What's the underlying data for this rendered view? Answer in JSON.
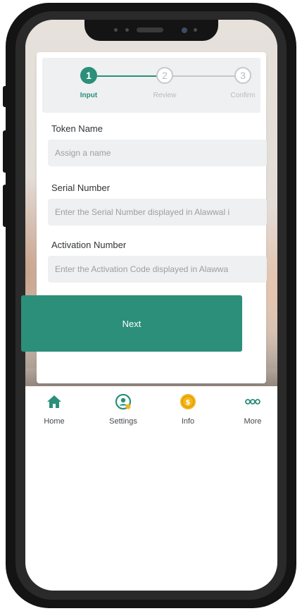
{
  "stepper": {
    "steps": [
      {
        "number": "1",
        "label": "Input"
      },
      {
        "number": "2",
        "label": "Review"
      },
      {
        "number": "3",
        "label": "Confirm"
      }
    ],
    "active_step": 1
  },
  "form": {
    "token_name": {
      "label": "Token Name",
      "placeholder": "Assign a name"
    },
    "serial_number": {
      "label": "Serial Number",
      "placeholder": "Enter the Serial Number displayed in Alawwal i"
    },
    "activation_number": {
      "label": "Activation Number",
      "placeholder": "Enter the Activation Code displayed in Alawwa"
    }
  },
  "next_button": {
    "label": "Next"
  },
  "bottom_nav": {
    "items": [
      {
        "label": "Home",
        "icon": "home-icon"
      },
      {
        "label": "Settings",
        "icon": "settings-user-icon"
      },
      {
        "label": "Info",
        "icon": "info-coin-icon"
      },
      {
        "label": "More",
        "icon": "more-dots-icon"
      }
    ]
  },
  "colors": {
    "accent": "#2b8f7a",
    "info_gold": "#f3b71a",
    "field_bg": "#eef0f1"
  }
}
